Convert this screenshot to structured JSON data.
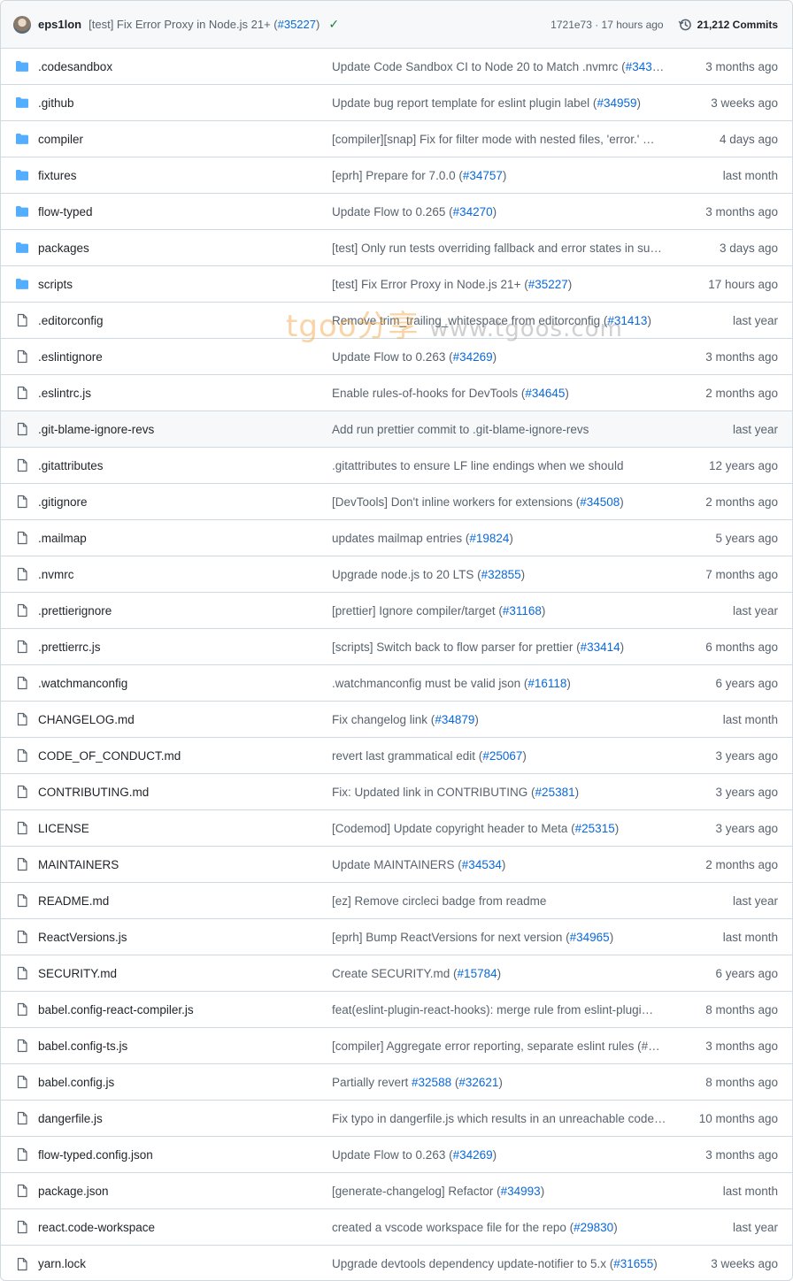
{
  "header": {
    "author": "eps1lon",
    "commit_message": "[test] Fix Error Proxy in Node.js 21+ (",
    "commit_link": "#35227",
    "commit_message_end": ")",
    "sha_time": "1721e73 · 17 hours ago",
    "commits_label": "21,212 Commits"
  },
  "watermark": {
    "main": "tgoo分享",
    "url": "www.tgoos.com"
  },
  "files": [
    {
      "type": "folder",
      "name": ".codesandbox",
      "message": "Update Code Sandbox CI to Node 20 to Match .nvmrc (#343…",
      "age": "3 months ago"
    },
    {
      "type": "folder",
      "name": ".github",
      "message": "Update bug report template for eslint plugin label (#34959)",
      "age": "3 weeks ago"
    },
    {
      "type": "folder",
      "name": "compiler",
      "message": "[compiler][snap] Fix for filter mode with nested files, 'error.' …",
      "age": "4 days ago"
    },
    {
      "type": "folder",
      "name": "fixtures",
      "message": "[eprh] Prepare for 7.0.0 (#34757)",
      "age": "last month"
    },
    {
      "type": "folder",
      "name": "flow-typed",
      "message": "Update Flow to 0.265 (#34270)",
      "age": "3 months ago"
    },
    {
      "type": "folder",
      "name": "packages",
      "message": "[test] Only run tests overriding fallback and error states in su…",
      "age": "3 days ago"
    },
    {
      "type": "folder",
      "name": "scripts",
      "message": "[test] Fix Error Proxy in Node.js 21+ (#35227)",
      "age": "17 hours ago"
    },
    {
      "type": "file",
      "name": ".editorconfig",
      "message": "Remove trim_trailing_whitespace from editorconfig (#31413)",
      "age": "last year"
    },
    {
      "type": "file",
      "name": ".eslintignore",
      "message": "Update Flow to 0.263 (#34269)",
      "age": "3 months ago"
    },
    {
      "type": "file",
      "name": ".eslintrc.js",
      "message": "Enable rules-of-hooks for DevTools (#34645)",
      "age": "2 months ago"
    },
    {
      "type": "file",
      "name": ".git-blame-ignore-revs",
      "message": "Add run prettier commit to .git-blame-ignore-revs",
      "age": "last year",
      "highlight": true
    },
    {
      "type": "file",
      "name": ".gitattributes",
      "message": ".gitattributes to ensure LF line endings when we should",
      "age": "12 years ago"
    },
    {
      "type": "file",
      "name": ".gitignore",
      "message": "[DevTools] Don't inline workers for extensions (#34508)",
      "age": "2 months ago"
    },
    {
      "type": "file",
      "name": ".mailmap",
      "message": "updates mailmap entries (#19824)",
      "age": "5 years ago"
    },
    {
      "type": "file",
      "name": ".nvmrc",
      "message": "Upgrade node.js to 20 LTS (#32855)",
      "age": "7 months ago"
    },
    {
      "type": "file",
      "name": ".prettierignore",
      "message": "[prettier] Ignore compiler/target (#31168)",
      "age": "last year"
    },
    {
      "type": "file",
      "name": ".prettierrc.js",
      "message": "[scripts] Switch back to flow parser for prettier (#33414)",
      "age": "6 months ago"
    },
    {
      "type": "file",
      "name": ".watchmanconfig",
      "message": ".watchmanconfig must be valid json (#16118)",
      "age": "6 years ago"
    },
    {
      "type": "file",
      "name": "CHANGELOG.md",
      "message": "Fix changelog link (#34879)",
      "age": "last month"
    },
    {
      "type": "file",
      "name": "CODE_OF_CONDUCT.md",
      "message": "revert last grammatical edit (#25067)",
      "age": "3 years ago"
    },
    {
      "type": "file",
      "name": "CONTRIBUTING.md",
      "message": "Fix: Updated link in CONTRIBUTING (#25381)",
      "age": "3 years ago"
    },
    {
      "type": "file",
      "name": "LICENSE",
      "message": "[Codemod] Update copyright header to Meta (#25315)",
      "age": "3 years ago"
    },
    {
      "type": "file",
      "name": "MAINTAINERS",
      "message": "Update MAINTAINERS (#34534)",
      "age": "2 months ago"
    },
    {
      "type": "file",
      "name": "README.md",
      "message": "[ez] Remove circleci badge from readme",
      "age": "last year"
    },
    {
      "type": "file",
      "name": "ReactVersions.js",
      "message": "[eprh] Bump ReactVersions for next version (#34965)",
      "age": "last month"
    },
    {
      "type": "file",
      "name": "SECURITY.md",
      "message": "Create SECURITY.md (#15784)",
      "age": "6 years ago"
    },
    {
      "type": "file",
      "name": "babel.config-react-compiler.js",
      "message": "feat(eslint-plugin-react-hooks): merge rule from eslint-plugi…",
      "age": "8 months ago"
    },
    {
      "type": "file",
      "name": "babel.config-ts.js",
      "message": "[compiler] Aggregate error reporting, separate eslint rules (#…",
      "age": "3 months ago"
    },
    {
      "type": "file",
      "name": "babel.config.js",
      "message": "Partially revert #32588 (#32621)",
      "age": "8 months ago"
    },
    {
      "type": "file",
      "name": "dangerfile.js",
      "message": "Fix typo in dangerfile.js which results in an unreachable code…",
      "age": "10 months ago"
    },
    {
      "type": "file",
      "name": "flow-typed.config.json",
      "message": "Update Flow to 0.263 (#34269)",
      "age": "3 months ago"
    },
    {
      "type": "file",
      "name": "package.json",
      "message": "[generate-changelog] Refactor (#34993)",
      "age": "last month"
    },
    {
      "type": "file",
      "name": "react.code-workspace",
      "message": "created a vscode workspace file for the repo (#29830)",
      "age": "last year"
    },
    {
      "type": "file",
      "name": "yarn.lock",
      "message": "Upgrade devtools dependency update-notifier to 5.x (#31655)",
      "age": "3 weeks ago"
    }
  ],
  "colors": {
    "folder": "#54aeff",
    "link": "#0969da",
    "muted": "#59636e",
    "success": "#1a7f37"
  }
}
